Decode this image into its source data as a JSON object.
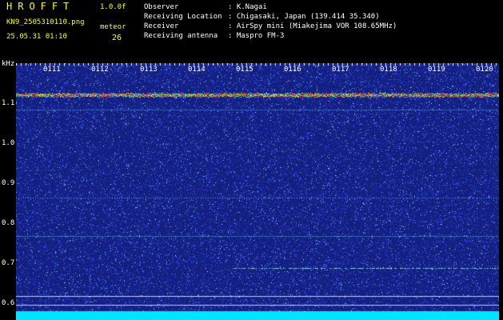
{
  "header": {
    "app_title": "HROFFT",
    "version": "1.0.0f",
    "filename": "KN9_2505310110.png",
    "datetime": "25.05.31 01:10",
    "meteor_label": "meteor",
    "meteor_count": "26",
    "info": [
      {
        "label": "Observer",
        "value": ": K.Nagai"
      },
      {
        "label": "Receiving Location",
        "value": ": Chigasaki, Japan (139.414 35.340)"
      },
      {
        "label": "Receiver",
        "value": ": AirSpy mini (Miakejima VOR 108.65MHz)"
      },
      {
        "label": "Receiving antenna",
        "value": ": Maspro FM-3"
      }
    ]
  },
  "spectrogram": {
    "unit_label": "kHz",
    "time_labels": [
      "0111",
      "0112",
      "0113",
      "0114",
      "0115",
      "0116",
      "0117",
      "0118",
      "0119",
      "0120"
    ],
    "freq_labels": [
      "1.1",
      "1.0",
      "0.9",
      "0.8",
      "0.7",
      "0.6"
    ],
    "colors": {
      "background": "#1a2a9a",
      "noise": "#3a5cff",
      "signal": "#ff3030",
      "floor": "#00e5ff"
    }
  }
}
